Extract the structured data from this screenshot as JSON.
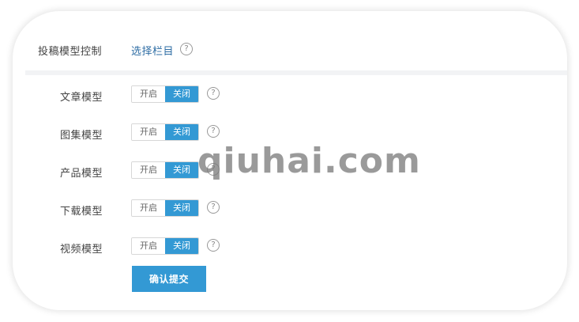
{
  "header": {
    "label": "投稿模型控制",
    "link": "选择栏目",
    "help_icon": "question-circle-icon"
  },
  "models": [
    {
      "label": "文章模型",
      "on_label": "开启",
      "off_label": "关闭",
      "selected": "关闭"
    },
    {
      "label": "图集模型",
      "on_label": "开启",
      "off_label": "关闭",
      "selected": "关闭"
    },
    {
      "label": "产品模型",
      "on_label": "开启",
      "off_label": "关闭",
      "selected": "关闭"
    },
    {
      "label": "下载模型",
      "on_label": "开启",
      "off_label": "关闭",
      "selected": "关闭"
    },
    {
      "label": "视频模型",
      "on_label": "开启",
      "off_label": "关闭",
      "selected": "关闭"
    }
  ],
  "submit_label": "确认提交",
  "watermark": "qiuhai.com",
  "colors": {
    "accent": "#3399d4",
    "link": "#2e6da4",
    "text": "#444444"
  }
}
